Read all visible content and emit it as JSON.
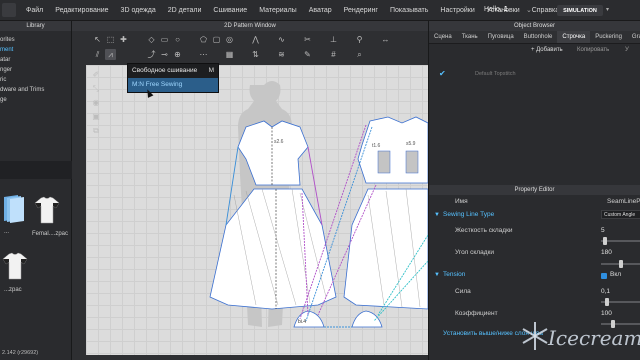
{
  "menubar": {
    "items": [
      "Файл",
      "Редактирование",
      "3D одежда",
      "2D детали",
      "Сшивание",
      "Материалы",
      "Аватар",
      "Рендеринг",
      "Показывать",
      "Настройки",
      "Установки",
      "Справка"
    ],
    "greeting_prefix": "Hello,",
    "greeting_number": "1",
    "simulation_label": "SIMULATION"
  },
  "library": {
    "title": "Library",
    "tree": [
      "orites",
      "ment",
      "atar",
      "nger",
      "ric",
      "dware and Trims",
      "ge"
    ],
    "selected_index": 1,
    "thumbs": [
      {
        "label": "..."
      },
      {
        "label": "Femal....zpac"
      },
      {
        "label": "...zpac"
      }
    ],
    "status": "2.142 (r29692)"
  },
  "pattern": {
    "title": "2D Pattern Window",
    "context_menu": [
      {
        "label": "Свободное сшивание",
        "shortcut": "M"
      },
      {
        "label": "M:N Free Sewing",
        "shortcut": ""
      }
    ],
    "labels": {
      "piece_label_a": "s2.6",
      "piece_label_b": "t1.6",
      "piece_label_c": "s5.9",
      "piece_label_d": "bi.4"
    }
  },
  "object_browser": {
    "title": "Object Browser",
    "tabs": [
      "Сцена",
      "Ткань",
      "Пуговица",
      "Buttonhole",
      "Строчка",
      "Puckering",
      "Gra"
    ],
    "active_tab": 4,
    "add_label": "+ Добавить",
    "copy_label": "Копировать",
    "delete_label": "У",
    "item_name": "Default Topstitch"
  },
  "property_editor": {
    "title": "Property Editor",
    "name_label": "Имя",
    "name_value": "SeamLinePart",
    "section_sewing": "Sewing Line Type",
    "sewing_type_value": "Custom Angle",
    "fold_strength_label": "Жесткость складки",
    "fold_strength_value": "5",
    "fold_angle_label": "Угол складки",
    "fold_angle_value": "180",
    "section_tension": "Tension",
    "tension_check_label": "Вкл",
    "force_label": "Сила",
    "force_value": "0,1",
    "coef_label": "Коэффициент",
    "coef_value": "100",
    "link_label": "Установить выше/ниже слоя шва"
  },
  "watermark": {
    "text": "Icecream"
  },
  "colors": {
    "accent": "#56c1ff",
    "panel": "#2a2b2e",
    "canvas": "#dcdcdc",
    "seam_purple": "#b050c8",
    "seam_blue": "#3a8fd8",
    "seam_teal": "#30c0c8"
  }
}
